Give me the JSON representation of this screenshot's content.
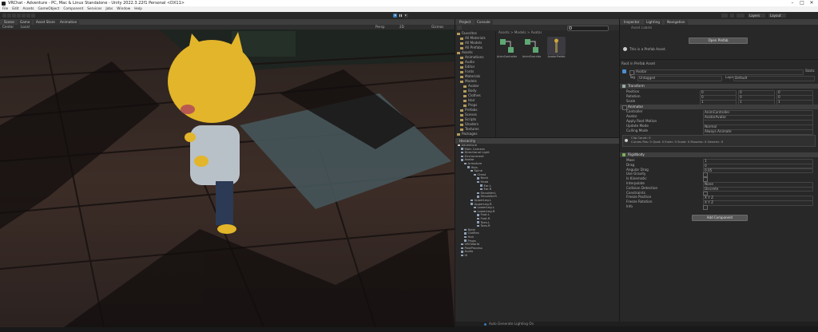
{
  "window": {
    "title": "VRChat - Adventure - PC, Mac & Linux Standalone - Unity 2022.3.22f1 Personal <DX11>",
    "controls": [
      "–",
      "□",
      "✕"
    ]
  },
  "menu": [
    "File",
    "Edit",
    "Assets",
    "GameObject",
    "Component",
    "Services",
    "Jobs",
    "Window",
    "Help"
  ],
  "toolbar": {
    "play_icon": "play-icon",
    "pause_icon": "pause-icon",
    "step_icon": "step-icon",
    "layers_label": "Layers",
    "layout_label": "Layout"
  },
  "scene": {
    "tabs": [
      "Scene",
      "Game",
      "Asset Store",
      "Animation"
    ],
    "toolbar_items": [
      "Center",
      "Local",
      "Persp",
      "2D",
      "Gizmos"
    ]
  },
  "project": {
    "tabs": [
      "Project",
      "Console"
    ],
    "search_placeholder": "",
    "breadcrumb": "Assets > Models > Avatar",
    "tree": [
      {
        "label": "Favorites",
        "depth": 0
      },
      {
        "label": "All Materials",
        "depth": 1
      },
      {
        "label": "All Models",
        "depth": 1
      },
      {
        "label": "All Prefabs",
        "depth": 1
      },
      {
        "label": "Assets",
        "depth": 0
      },
      {
        "label": "Animations",
        "depth": 1
      },
      {
        "label": "Audio",
        "depth": 1
      },
      {
        "label": "Editor",
        "depth": 1
      },
      {
        "label": "Fonts",
        "depth": 1
      },
      {
        "label": "Materials",
        "depth": 1
      },
      {
        "label": "Models",
        "depth": 1
      },
      {
        "label": "Avatar",
        "depth": 2
      },
      {
        "label": "Body",
        "depth": 2
      },
      {
        "label": "Clothes",
        "depth": 2
      },
      {
        "label": "Hair",
        "depth": 2
      },
      {
        "label": "Props",
        "depth": 2
      },
      {
        "label": "Prefabs",
        "depth": 1
      },
      {
        "label": "Scenes",
        "depth": 1
      },
      {
        "label": "Scripts",
        "depth": 1
      },
      {
        "label": "Shaders",
        "depth": 1
      },
      {
        "label": "Textures",
        "depth": 1
      },
      {
        "label": "Packages",
        "depth": 0
      }
    ],
    "assets": [
      {
        "label": "AnimController",
        "color": "#5fa874"
      },
      {
        "label": "AnimOverride",
        "color": "#5fa874"
      },
      {
        "label": "AvatarPrefab",
        "color": "#3a3a40"
      }
    ]
  },
  "hierarchy": {
    "tab": "Hierarchy",
    "items": [
      {
        "label": "Adventure",
        "depth": 0
      },
      {
        "label": "Main Camera",
        "depth": 1
      },
      {
        "label": "Directional Light",
        "depth": 1
      },
      {
        "label": "Environment",
        "depth": 1
      },
      {
        "label": "Avatar",
        "depth": 1
      },
      {
        "label": "Armature",
        "depth": 2
      },
      {
        "label": "Hips",
        "depth": 3
      },
      {
        "label": "Spine",
        "depth": 4
      },
      {
        "label": "Chest",
        "depth": 5
      },
      {
        "label": "Neck",
        "depth": 6
      },
      {
        "label": "Head",
        "depth": 6
      },
      {
        "label": "Ear.L",
        "depth": 7
      },
      {
        "label": "Ear.R",
        "depth": 7
      },
      {
        "label": "Shoulder.L",
        "depth": 6
      },
      {
        "label": "Shoulder.R",
        "depth": 6
      },
      {
        "label": "UpperLeg.L",
        "depth": 4
      },
      {
        "label": "UpperLeg.R",
        "depth": 4
      },
      {
        "label": "LowerLeg.L",
        "depth": 5
      },
      {
        "label": "LowerLeg.R",
        "depth": 5
      },
      {
        "label": "Foot.L",
        "depth": 6
      },
      {
        "label": "Foot.R",
        "depth": 6
      },
      {
        "label": "Toes.L",
        "depth": 6
      },
      {
        "label": "Toes.R",
        "depth": 6
      },
      {
        "label": "Body",
        "depth": 2
      },
      {
        "label": "Clothes",
        "depth": 2
      },
      {
        "label": "Hair",
        "depth": 2
      },
      {
        "label": "Props",
        "depth": 2
      },
      {
        "label": "VRCWorld",
        "depth": 1
      },
      {
        "label": "PostProcess",
        "depth": 1
      },
      {
        "label": "Audio",
        "depth": 1
      },
      {
        "label": "UI",
        "depth": 1
      }
    ]
  },
  "inspector": {
    "tabs": [
      "Inspector",
      "Lighting",
      "Navigation"
    ],
    "header_note": "Asset Labels",
    "open_prefab_button": "Open Prefab",
    "info_text": "This is a Prefab Asset.",
    "section_label": "Root in Prefab Asset",
    "object_name": "Avatar",
    "tag_label": "Tag",
    "tag_value": "Untagged",
    "layer_label": "Layer",
    "layer_value": "Default",
    "static_label": "Static",
    "transform": {
      "title": "Transform",
      "rows": [
        {
          "label": "Position",
          "x": "0",
          "y": "0",
          "z": "0"
        },
        {
          "label": "Rotation",
          "x": "0",
          "y": "0",
          "z": "0"
        },
        {
          "label": "Scale",
          "x": "1",
          "y": "1",
          "z": "1"
        }
      ]
    },
    "animator": {
      "title": "Animator",
      "rows": [
        {
          "label": "Controller",
          "value": "AnimController"
        },
        {
          "label": "Avatar",
          "value": "AvatarAvatar"
        },
        {
          "label": "Apply Root Motion",
          "value": ""
        },
        {
          "label": "Update Mode",
          "value": "Normal"
        },
        {
          "label": "Culling Mode",
          "value": "Always Animate"
        }
      ],
      "info": "Clip Count: 0\nCurves Pos: 0 Quat: 0 Euler: 0 Scale: 0 Muscles: 0 Generic: 0"
    },
    "rigidbody": {
      "title": "Rigidbody",
      "rows": [
        {
          "label": "Mass",
          "value": "1"
        },
        {
          "label": "Drag",
          "value": "0"
        },
        {
          "label": "Angular Drag",
          "value": "0.05"
        },
        {
          "label": "Use Gravity",
          "value": ""
        },
        {
          "label": "Is Kinematic",
          "value": ""
        },
        {
          "label": "Interpolate",
          "value": "None"
        },
        {
          "label": "Collision Detection",
          "value": "Discrete"
        },
        {
          "label": "Constraints",
          "value": ""
        },
        {
          "label": "Freeze Position",
          "value": "X Y Z"
        },
        {
          "label": "Freeze Rotation",
          "value": "X Y Z"
        },
        {
          "label": "Info",
          "value": ""
        }
      ]
    },
    "add_component_button": "Add Component"
  },
  "statusbar": {
    "text": "Auto Generate Lighting On"
  },
  "colors": {
    "accent": "#3a79bb",
    "background": "#191919",
    "panel": "#282828",
    "header": "#3e3e3e",
    "titlebar": "#ffffff"
  }
}
